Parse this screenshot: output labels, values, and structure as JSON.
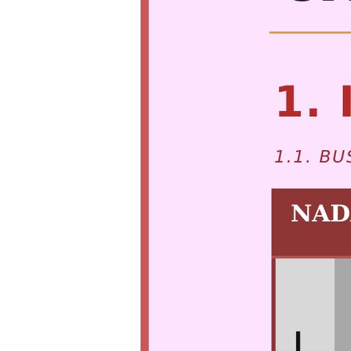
{
  "document": {
    "title_fragment": "UN",
    "section_heading": "1. I",
    "subsection_heading": "1.1. BUS",
    "table": {
      "header_text": "NADA",
      "first_cell_text": "I"
    }
  },
  "colors": {
    "page_background": "#fde3fd",
    "left_border": "#c9585a",
    "rule": "#d99a4a",
    "section_heading": "#b22a2a",
    "subsection_heading": "#9a2a30",
    "table_header": "#8e3636",
    "cell_light": "#d8d8d8",
    "cell_dark": "#a8a8a8"
  }
}
